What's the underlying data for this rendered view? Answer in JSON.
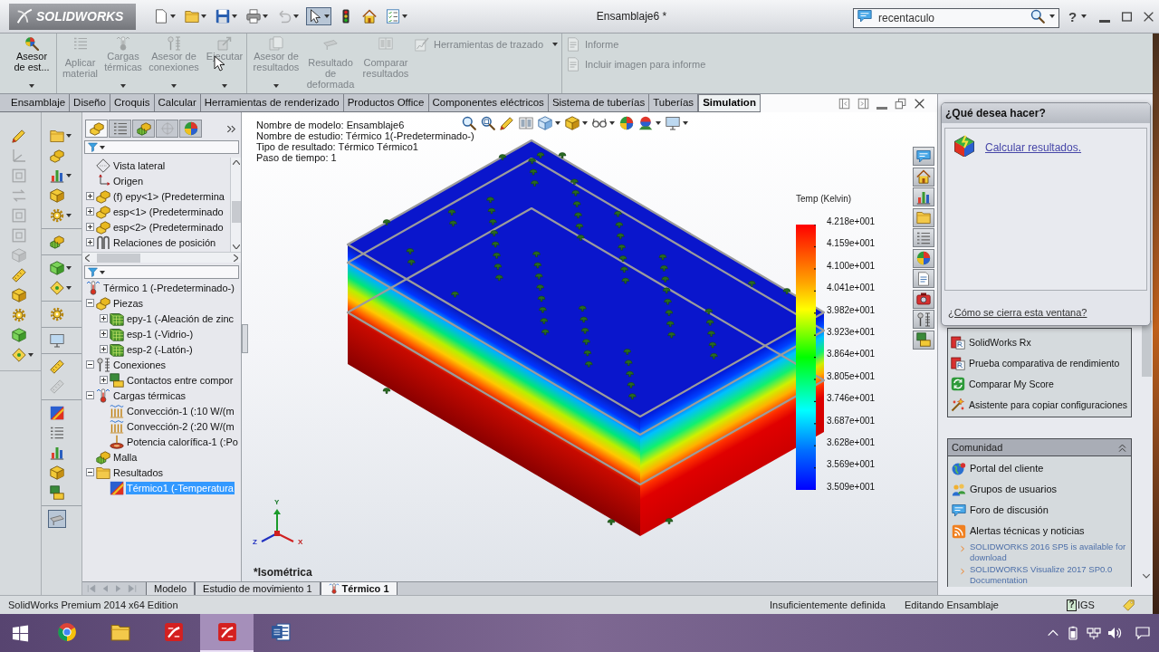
{
  "window": {
    "logo": "SOLIDWORKS",
    "title": "Ensamblaje6 *",
    "help": "?"
  },
  "quick_access": [
    {
      "dropdown": true,
      "disabled": false,
      "selected": false
    },
    {
      "dropdown": true,
      "disabled": false,
      "selected": false
    },
    {
      "dropdown": true,
      "disabled": false,
      "selected": false
    },
    {
      "dropdown": true,
      "disabled": false,
      "selected": false
    },
    {
      "dropdown": true,
      "disabled": true,
      "selected": false
    },
    {
      "dropdown": true,
      "disabled": false,
      "selected": true
    },
    {
      "dropdown": false,
      "disabled": false,
      "selected": false
    },
    {
      "dropdown": false,
      "disabled": false,
      "selected": false
    },
    {
      "dropdown": true,
      "disabled": false,
      "selected": false
    }
  ],
  "search": {
    "value": "recentaculo"
  },
  "ribbon": [
    {
      "buttons": [
        {
          "label": "Asesor de est...",
          "disabled": false,
          "dropdown": true
        }
      ]
    },
    {
      "buttons": [
        {
          "label": "Aplicar material",
          "disabled": true,
          "dropdown": false
        },
        {
          "label": "Cargas térmicas",
          "disabled": true,
          "dropdown": true
        },
        {
          "label": "Asesor de conexiones",
          "disabled": true,
          "dropdown": true
        },
        {
          "label": "Ejecutar",
          "disabled": true,
          "dropdown": true
        }
      ]
    },
    {
      "buttons": [
        {
          "label": "Asesor de resultados",
          "disabled": true,
          "dropdown": true
        },
        {
          "label": "Resultado de deformada",
          "disabled": true,
          "dropdown": false
        },
        {
          "label": "Comparar resultados",
          "disabled": true,
          "dropdown": false
        }
      ],
      "tools": [
        {
          "label": "Herramientas de trazado",
          "disabled": true,
          "dropdown": true
        }
      ]
    },
    {
      "tools": [
        {
          "label": "Informe",
          "disabled": true,
          "dropdown": false
        },
        {
          "label": "Incluir imagen para informe",
          "disabled": true,
          "dropdown": false
        }
      ]
    }
  ],
  "command_tabs": [
    {
      "label": "Ensamblaje",
      "selected": false
    },
    {
      "label": "Diseño",
      "selected": false
    },
    {
      "label": "Croquis",
      "selected": false
    },
    {
      "label": "Calcular",
      "selected": false
    },
    {
      "label": "Herramientas de renderizado",
      "selected": false
    },
    {
      "label": "Productos Office",
      "selected": false
    },
    {
      "label": "Componentes eléctricos",
      "selected": false
    },
    {
      "label": "Sistema de tuberías",
      "selected": false
    },
    {
      "label": "Tuberías",
      "selected": false
    },
    {
      "label": "Simulation",
      "selected": true
    }
  ],
  "cad_toolbar": [
    {
      "disabled": false,
      "dropdown": false
    },
    {
      "disabled": true,
      "dropdown": false
    },
    {
      "disabled": true,
      "dropdown": false
    },
    {
      "disabled": true,
      "dropdown": false
    },
    {
      "disabled": true,
      "dropdown": false
    },
    {
      "disabled": true,
      "dropdown": false
    },
    {
      "disabled": true,
      "dropdown": false
    },
    {
      "disabled": false,
      "dropdown": false
    },
    {
      "disabled": false,
      "dropdown": false
    },
    {
      "disabled": false,
      "dropdown": false
    },
    {
      "disabled": false,
      "dropdown": false
    },
    {
      "disabled": false,
      "dropdown": true
    }
  ],
  "simulation_toolbar": [
    [
      {
        "disabled": false,
        "dropdown": true,
        "selected": false
      },
      {
        "disabled": false,
        "dropdown": false,
        "selected": false
      },
      {
        "disabled": false,
        "dropdown": true,
        "selected": false
      },
      {
        "disabled": false,
        "dropdown": false,
        "selected": false
      },
      {
        "disabled": false,
        "dropdown": true,
        "selected": false
      }
    ],
    [
      {
        "disabled": false,
        "dropdown": false,
        "selected": false
      }
    ],
    [
      {
        "disabled": false,
        "dropdown": true,
        "selected": false
      },
      {
        "disabled": false,
        "dropdown": true,
        "selected": false
      }
    ],
    [
      {
        "disabled": false,
        "dropdown": false,
        "selected": false
      }
    ],
    [
      {
        "disabled": false,
        "dropdown": false,
        "selected": false
      }
    ],
    [
      {
        "disabled": false,
        "dropdown": false,
        "selected": false
      },
      {
        "disabled": true,
        "dropdown": false,
        "selected": false
      }
    ],
    [
      {
        "disabled": false,
        "dropdown": false,
        "selected": false
      },
      {
        "disabled": false,
        "dropdown": false,
        "selected": false
      },
      {
        "disabled": false,
        "dropdown": false,
        "selected": false
      },
      {
        "disabled": false,
        "dropdown": false,
        "selected": false
      },
      {
        "disabled": false,
        "dropdown": false,
        "selected": false
      }
    ],
    [
      {
        "disabled": false,
        "dropdown": false,
        "selected": true
      }
    ]
  ],
  "feature_manager": {
    "tabs": [
      {
        "selected": true,
        "disabled": false
      },
      {
        "selected": false,
        "disabled": false
      },
      {
        "selected": false,
        "disabled": false
      },
      {
        "selected": false,
        "disabled": true
      },
      {
        "selected": false,
        "disabled": false
      }
    ],
    "tree": [
      {
        "label": "Vista lateral",
        "kind": "plane",
        "selected": false
      },
      {
        "label": "Origen",
        "kind": "origin",
        "selected": false
      },
      {
        "label": "(f) epy<1> (Predetermina",
        "kind": "part",
        "expanded": false,
        "selected": false
      },
      {
        "label": "esp<1> (Predeterminado",
        "kind": "part",
        "expanded": false,
        "selected": false
      },
      {
        "label": "esp<2> (Predeterminado",
        "kind": "part",
        "expanded": false,
        "selected": false
      },
      {
        "label": "Relaciones de posición",
        "kind": "mates",
        "expanded": false,
        "selected": false
      }
    ],
    "study_tree": {
      "label": "Térmico 1 (-Predeterminado-)",
      "kind": "study",
      "selected": false,
      "children": [
        {
          "label": "Piezas",
          "kind": "parts",
          "expanded": true,
          "selected": false,
          "children": [
            {
              "label": "epy-1 (-Aleación de zinc",
              "kind": "solid",
              "expanded": false,
              "selected": false
            },
            {
              "label": "esp-1 (-Vidrio-)",
              "kind": "solid",
              "expanded": false,
              "selected": false
            },
            {
              "label": "esp-2 (-Latón-)",
              "kind": "solid",
              "expanded": false,
              "selected": false
            }
          ]
        },
        {
          "label": "Conexiones",
          "kind": "connections",
          "expanded": true,
          "selected": false,
          "children": [
            {
              "label": "Contactos entre compor",
              "kind": "contact",
              "expanded": false,
              "selected": false
            }
          ]
        },
        {
          "label": "Cargas térmicas",
          "kind": "loads",
          "expanded": true,
          "selected": false,
          "children": [
            {
              "label": "Convección-1 (:10 W/(m",
              "kind": "convection",
              "selected": false
            },
            {
              "label": "Convección-2 (:20 W/(m",
              "kind": "convection",
              "selected": false
            },
            {
              "label": "Potencia calorífica-1 (:Po",
              "kind": "heat_power",
              "selected": false
            }
          ]
        },
        {
          "label": "Malla",
          "kind": "mesh",
          "selected": false
        },
        {
          "label": "Resultados",
          "kind": "results",
          "expanded": true,
          "selected": false,
          "children": [
            {
              "label": "Térmico1 (-Temperatura",
              "kind": "plot",
              "selected": true
            }
          ]
        }
      ]
    }
  },
  "graphics": {
    "info": [
      "Nombre de modelo: Ensamblaje6",
      "Nombre de estudio: Térmico 1(-Predeterminado-)",
      "Tipo de resultado: Térmico Térmico1",
      "Paso de tiempo: 1"
    ],
    "legend": {
      "title": "Temp (Kelvin)",
      "labels": [
        "4.218e+001",
        "4.159e+001",
        "4.100e+001",
        "4.041e+001",
        "3.982e+001",
        "3.923e+001",
        "3.864e+001",
        "3.805e+001",
        "3.746e+001",
        "3.687e+001",
        "3.628e+001",
        "3.569e+001",
        "3.509e+001"
      ]
    },
    "axes": [
      "Y",
      "X",
      "Z"
    ],
    "view": "*Isométrica"
  },
  "task_pane": {
    "popup": {
      "title": "¿Qué desea hacer?",
      "action": "Calcular resultados.",
      "help_link": "¿Cómo se cierra esta ventana?"
    },
    "resources": [
      {
        "label": "SolidWorks Rx",
        "kind": "rx"
      },
      {
        "label": "Prueba comparativa de rendimiento",
        "kind": "benchmark"
      },
      {
        "label": "Comparar My Score",
        "kind": "score"
      },
      {
        "label": "Asistente para copiar configuraciones",
        "kind": "wizard"
      }
    ],
    "community": {
      "title": "Comunidad",
      "expanded": true,
      "items": [
        {
          "label": "Portal del cliente",
          "kind": "portal"
        },
        {
          "label": "Grupos de usuarios",
          "kind": "groups"
        },
        {
          "label": "Foro de discusión",
          "kind": "forum"
        },
        {
          "label": "Alertas técnicas y noticias",
          "kind": "feed"
        }
      ],
      "news": [
        "SOLIDWORKS 2016 SP5 is available for download",
        "SOLIDWORKS Visualize 2017 SP0.0 Documentation"
      ]
    }
  },
  "bottom_tabs": [
    {
      "label": "Modelo",
      "kind": "model",
      "selected": false
    },
    {
      "label": "Estudio de movimiento 1",
      "kind": "motion",
      "selected": false
    },
    {
      "label": "Térmico 1",
      "kind": "study",
      "selected": true
    }
  ],
  "status_bar": {
    "edition": "SolidWorks Premium 2014 x64 Edition",
    "definition": "Insuficientemente definida",
    "mode": "Editando Ensamblaje",
    "help": "?",
    "units": "IGS"
  },
  "taskbar": {
    "apps": [
      {
        "kind": "browser",
        "selected": false
      },
      {
        "kind": "files",
        "selected": false
      },
      {
        "kind": "cad",
        "selected": false
      },
      {
        "kind": "cad",
        "selected": true
      },
      {
        "kind": "word",
        "selected": false
      }
    ]
  }
}
